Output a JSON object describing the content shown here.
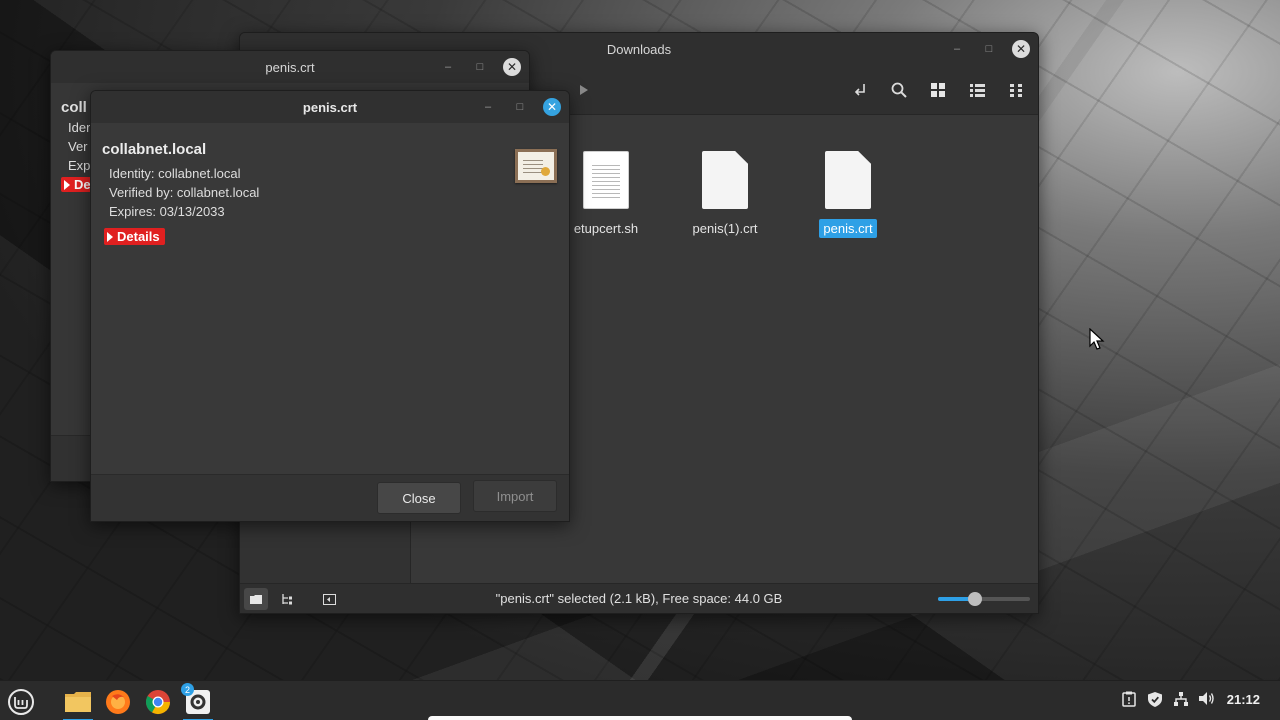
{
  "downloads_window": {
    "title": "Downloads",
    "files": [
      {
        "name": "etupcert.sh",
        "selected": false
      },
      {
        "name": "penis(1).crt",
        "selected": false
      },
      {
        "name": "penis.crt",
        "selected": true
      }
    ],
    "status_text": "\"penis.crt\" selected (2.1 kB), Free space: 44.0 GB",
    "toolbar_icons": [
      "back-arrow-icon",
      "location-toggle-icon",
      "search-icon",
      "grid-view-icon",
      "list-view-icon",
      "compact-view-icon"
    ],
    "zoom_level": 0.4
  },
  "back_dialog": {
    "title": "penis.crt",
    "heading": "coll",
    "lines": [
      "Ider",
      "Ver",
      "Expi"
    ],
    "details_label": "De"
  },
  "cert_dialog": {
    "title": "penis.crt",
    "name": "collabnet.local",
    "identity": "Identity: collabnet.local",
    "verified_by": "Verified by: collabnet.local",
    "expires": "Expires: 03/13/2033",
    "details_label": "Details",
    "close_label": "Close",
    "import_label": "Import"
  },
  "window_controls": {
    "minimize": "–",
    "maximize": "□",
    "close": "✕"
  },
  "taskbar": {
    "apps": [
      "mint-menu-icon",
      "files-icon",
      "firefox-icon",
      "chrome-icon",
      "settings-icon"
    ],
    "settings_badge": "2",
    "clock": "21:12"
  },
  "colors": {
    "accent": "#2ea0e6",
    "details_red": "#e02020"
  }
}
